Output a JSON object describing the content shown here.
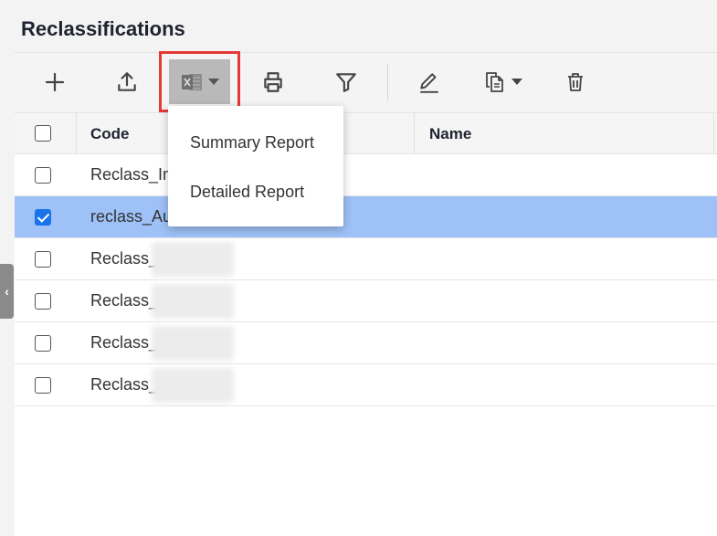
{
  "page": {
    "title": "Reclassifications"
  },
  "toolbar": {
    "buttons": [
      {
        "name": "add-button",
        "icon": "plus-icon"
      },
      {
        "name": "upload-button",
        "icon": "upload-icon"
      },
      {
        "name": "excel-export-button",
        "icon": "excel-icon"
      },
      {
        "name": "print-button",
        "icon": "printer-icon"
      },
      {
        "name": "filter-button",
        "icon": "filter-icon"
      },
      {
        "name": "edit-button",
        "icon": "pencil-icon"
      },
      {
        "name": "copy-button",
        "icon": "copy-icon"
      },
      {
        "name": "delete-button",
        "icon": "trash-icon"
      }
    ],
    "highlight_color": "#e53935"
  },
  "table": {
    "columns": [
      "Code",
      "Name"
    ],
    "rows": [
      {
        "code": "Reclass_Im",
        "checked": false,
        "selected": false
      },
      {
        "code": "reclass_Au",
        "checked": true,
        "selected": true
      },
      {
        "code": "Reclass_",
        "checked": false,
        "selected": false
      },
      {
        "code": "Reclass_",
        "checked": false,
        "selected": false
      },
      {
        "code": "Reclass_",
        "checked": false,
        "selected": false
      },
      {
        "code": "Reclass_",
        "checked": false,
        "selected": false
      }
    ],
    "selected_row_color": "#9ec1f7"
  },
  "dropdown": {
    "items": [
      "Summary Report",
      "Detailed Report"
    ]
  }
}
